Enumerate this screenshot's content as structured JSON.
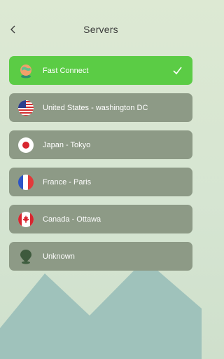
{
  "header": {
    "title": "Servers",
    "back_icon": "chevron-left-icon"
  },
  "servers": [
    {
      "label": "Fast Connect",
      "icon": "globe-pin-icon",
      "selected": true
    },
    {
      "label": "United States - washington DC",
      "icon": "us-flag-icon",
      "selected": false
    },
    {
      "label": "Japan - Tokyo",
      "icon": "japan-flag-icon",
      "selected": false
    },
    {
      "label": "France - Paris",
      "icon": "france-flag-icon",
      "selected": false
    },
    {
      "label": "Canada - Ottawa",
      "icon": "canada-flag-icon",
      "selected": false
    },
    {
      "label": "Unknown",
      "icon": "location-pin-icon",
      "selected": false
    }
  ],
  "colors": {
    "selected_row": "#5bcc45",
    "row": "#8d9a86",
    "background": "#dde9d3",
    "mountains": "#9fc2bb"
  }
}
